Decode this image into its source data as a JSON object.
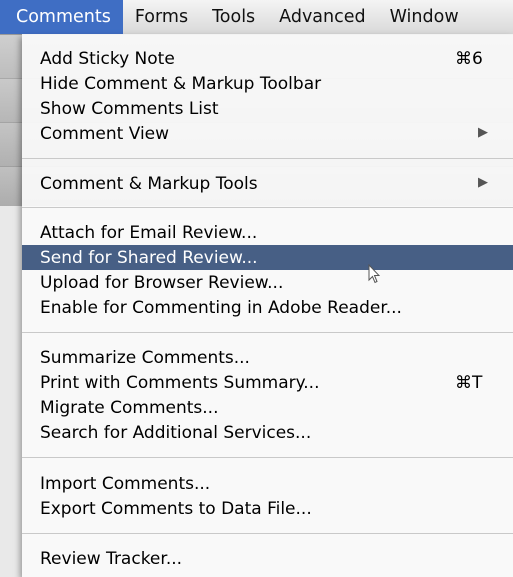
{
  "menubar": {
    "items": [
      "Comments",
      "Forms",
      "Tools",
      "Advanced",
      "Window"
    ],
    "active": "Comments"
  },
  "menu": {
    "items": [
      {
        "label": "Add Sticky Note",
        "shortcut": "⌘6"
      },
      {
        "label": "Hide Comment & Markup Toolbar"
      },
      {
        "label": "Show Comments List"
      },
      {
        "label": "Comment View",
        "submenu": true
      },
      {
        "label": "Comment & Markup Tools",
        "submenu": true
      },
      {
        "label": "Attach for Email Review..."
      },
      {
        "label": "Send for Shared Review...",
        "highlighted": true
      },
      {
        "label": "Upload for Browser Review..."
      },
      {
        "label": "Enable for Commenting in Adobe Reader..."
      },
      {
        "label": "Summarize Comments..."
      },
      {
        "label": "Print with Comments Summary...",
        "shortcut": "⌘T"
      },
      {
        "label": "Migrate Comments..."
      },
      {
        "label": "Search for Additional Services..."
      },
      {
        "label": "Import Comments..."
      },
      {
        "label": "Export Comments to Data File..."
      },
      {
        "label": "Review Tracker..."
      }
    ]
  },
  "icons": {
    "submenu": "submenu-arrow-icon",
    "cursor": "arrow-cursor-icon"
  },
  "colors": {
    "highlight": "#475f85",
    "active_menu": "#3f6ec4"
  }
}
